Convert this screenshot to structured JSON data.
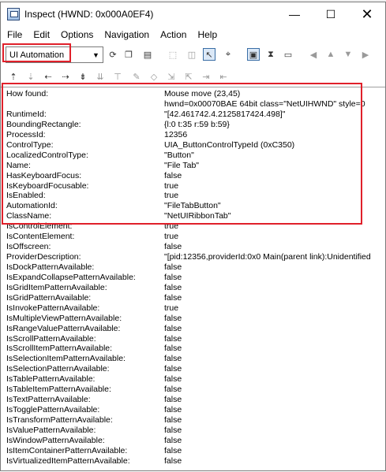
{
  "window": {
    "title": "Inspect  (HWND: 0x000A0EF4)",
    "minimize": "—",
    "maximize": "☐",
    "close": "✕"
  },
  "menu": [
    "File",
    "Edit",
    "Options",
    "Navigation",
    "Action",
    "Help"
  ],
  "toolbar": {
    "mode_selected": "UI Automation",
    "accent_red": "#e0202a"
  },
  "how_found": {
    "label": "How found:",
    "line1": "Mouse move (23,45)",
    "line2": "hwnd=0x00070BAE 64bit class=\"NetUIHWND\" style=0"
  },
  "properties": [
    {
      "name": "RuntimeId:",
      "value": "\"[42.461742.4.2125817424.498]\""
    },
    {
      "name": "BoundingRectangle:",
      "value": "{l:0 t:35 r:59 b:59}"
    },
    {
      "name": "ProcessId:",
      "value": "12356"
    },
    {
      "name": "ControlType:",
      "value": "UIA_ButtonControlTypeId (0xC350)"
    },
    {
      "name": "LocalizedControlType:",
      "value": "\"Button\""
    },
    {
      "name": "Name:",
      "value": "\"File Tab\""
    },
    {
      "name": "HasKeyboardFocus:",
      "value": "false"
    },
    {
      "name": "IsKeyboardFocusable:",
      "value": "true"
    },
    {
      "name": "IsEnabled:",
      "value": "true"
    },
    {
      "name": "AutomationId:",
      "value": "\"FileTabButton\""
    },
    {
      "name": "ClassName:",
      "value": "\"NetUIRibbonTab\""
    },
    {
      "name": "IsControlElement:",
      "value": "true"
    },
    {
      "name": "IsContentElement:",
      "value": "true"
    },
    {
      "name": "IsOffscreen:",
      "value": "false"
    },
    {
      "name": "ProviderDescription:",
      "value": "\"[pid:12356,providerId:0x0 Main(parent link):Unidentified"
    },
    {
      "name": "IsDockPatternAvailable:",
      "value": "false"
    },
    {
      "name": "IsExpandCollapsePatternAvailable:",
      "value": "false"
    },
    {
      "name": "IsGridItemPatternAvailable:",
      "value": "false"
    },
    {
      "name": "IsGridPatternAvailable:",
      "value": "false"
    },
    {
      "name": "IsInvokePatternAvailable:",
      "value": "true"
    },
    {
      "name": "IsMultipleViewPatternAvailable:",
      "value": "false"
    },
    {
      "name": "IsRangeValuePatternAvailable:",
      "value": "false"
    },
    {
      "name": "IsScrollPatternAvailable:",
      "value": "false"
    },
    {
      "name": "IsScrollItemPatternAvailable:",
      "value": "false"
    },
    {
      "name": "IsSelectionItemPatternAvailable:",
      "value": "false"
    },
    {
      "name": "IsSelectionPatternAvailable:",
      "value": "false"
    },
    {
      "name": "IsTablePatternAvailable:",
      "value": "false"
    },
    {
      "name": "IsTableItemPatternAvailable:",
      "value": "false"
    },
    {
      "name": "IsTextPatternAvailable:",
      "value": "false"
    },
    {
      "name": "IsTogglePatternAvailable:",
      "value": "false"
    },
    {
      "name": "IsTransformPatternAvailable:",
      "value": "false"
    },
    {
      "name": "IsValuePatternAvailable:",
      "value": "false"
    },
    {
      "name": "IsWindowPatternAvailable:",
      "value": "false"
    },
    {
      "name": "IsItemContainerPatternAvailable:",
      "value": "false"
    },
    {
      "name": "IsVirtualizedItemPatternAvailable:",
      "value": "false"
    }
  ]
}
